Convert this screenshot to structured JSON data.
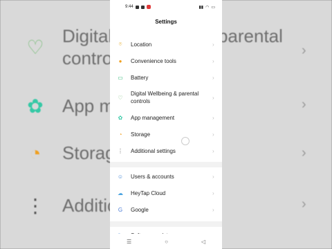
{
  "status": {
    "time": "9:44"
  },
  "header": {
    "title": "Settings"
  },
  "items": [
    {
      "label": "Location",
      "icon": "location-icon"
    },
    {
      "label": "Convenience tools",
      "icon": "tools-icon"
    },
    {
      "label": "Battery",
      "icon": "battery-icon"
    },
    {
      "label": "Digital Wellbeing & parental controls",
      "icon": "wellbeing-icon"
    },
    {
      "label": "App management",
      "icon": "apps-icon"
    },
    {
      "label": "Storage",
      "icon": "storage-icon"
    },
    {
      "label": "Additional settings",
      "icon": "more-settings-icon"
    },
    {
      "label": "Users & accounts",
      "icon": "user-icon"
    },
    {
      "label": "HeyTap Cloud",
      "icon": "cloud-icon"
    },
    {
      "label": "Google",
      "icon": "google-icon"
    },
    {
      "label": "Software update",
      "icon": "update-icon"
    }
  ],
  "background": {
    "rows": [
      {
        "label": "Digital Wellbeing & parental controls"
      },
      {
        "label": "App management"
      },
      {
        "label": "Storage"
      },
      {
        "label": "Additional settings"
      }
    ]
  },
  "colors": {
    "accent_green": "#2bb673",
    "accent_orange": "#f0a020",
    "accent_teal": "#36c9a6"
  }
}
